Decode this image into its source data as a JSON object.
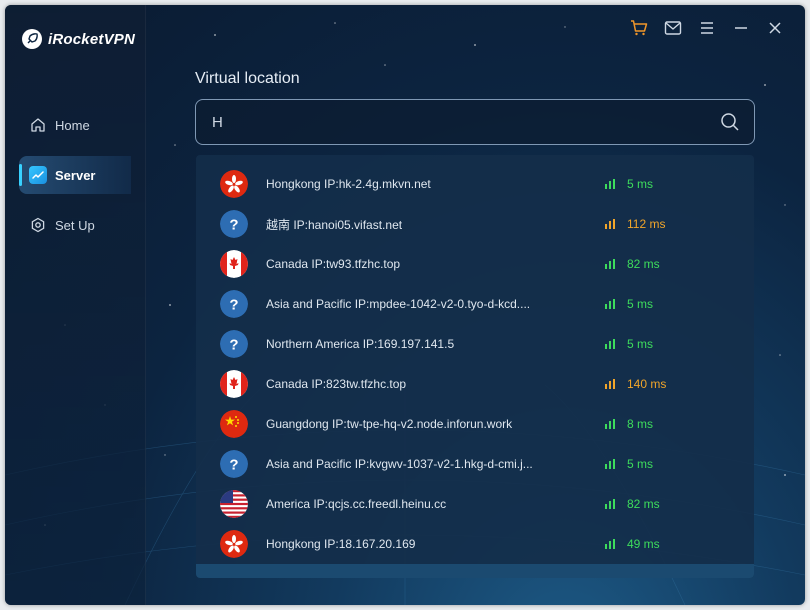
{
  "app": {
    "name": "iRocketVPN"
  },
  "sidebar": {
    "items": [
      {
        "label": "Home",
        "icon": "home-icon",
        "active": false
      },
      {
        "label": "Server",
        "icon": "server-icon",
        "active": true
      },
      {
        "label": "Set Up",
        "icon": "settings-icon",
        "active": false
      }
    ]
  },
  "titlebar": {
    "icons": [
      "cart-icon",
      "mail-icon",
      "menu-icon",
      "minimize-icon",
      "close-icon"
    ],
    "cart_color": "#f0962a"
  },
  "main": {
    "section_title": "Virtual location",
    "search": {
      "value": "H",
      "placeholder": ""
    }
  },
  "servers": [
    {
      "flag": "hk",
      "label": "Hongkong IP:hk-2.4g.mkvn.net",
      "ping": "5 ms",
      "quality": "green"
    },
    {
      "flag": "unknown",
      "label": "越南 IP:hanoi05.vifast.net",
      "ping": "112 ms",
      "quality": "orange"
    },
    {
      "flag": "ca",
      "label": "Canada IP:tw93.tfzhc.top",
      "ping": "82 ms",
      "quality": "green"
    },
    {
      "flag": "unknown",
      "label": "Asia and Pacific IP:mpdee-1042-v2-0.tyo-d-kcd....",
      "ping": "5 ms",
      "quality": "green"
    },
    {
      "flag": "unknown",
      "label": "Northern America IP:169.197.141.5",
      "ping": "5 ms",
      "quality": "green"
    },
    {
      "flag": "ca",
      "label": "Canada IP:823tw.tfzhc.top",
      "ping": "140 ms",
      "quality": "orange"
    },
    {
      "flag": "cn",
      "label": "Guangdong IP:tw-tpe-hq-v2.node.inforun.work",
      "ping": "8 ms",
      "quality": "green"
    },
    {
      "flag": "unknown",
      "label": "Asia and Pacific IP:kvgwv-1037-v2-1.hkg-d-cmi.j...",
      "ping": "5 ms",
      "quality": "green"
    },
    {
      "flag": "us",
      "label": "America IP:qcjs.cc.freedl.heinu.cc",
      "ping": "82 ms",
      "quality": "green"
    },
    {
      "flag": "hk",
      "label": "Hongkong IP:18.167.20.169",
      "ping": "49 ms",
      "quality": "green"
    }
  ]
}
